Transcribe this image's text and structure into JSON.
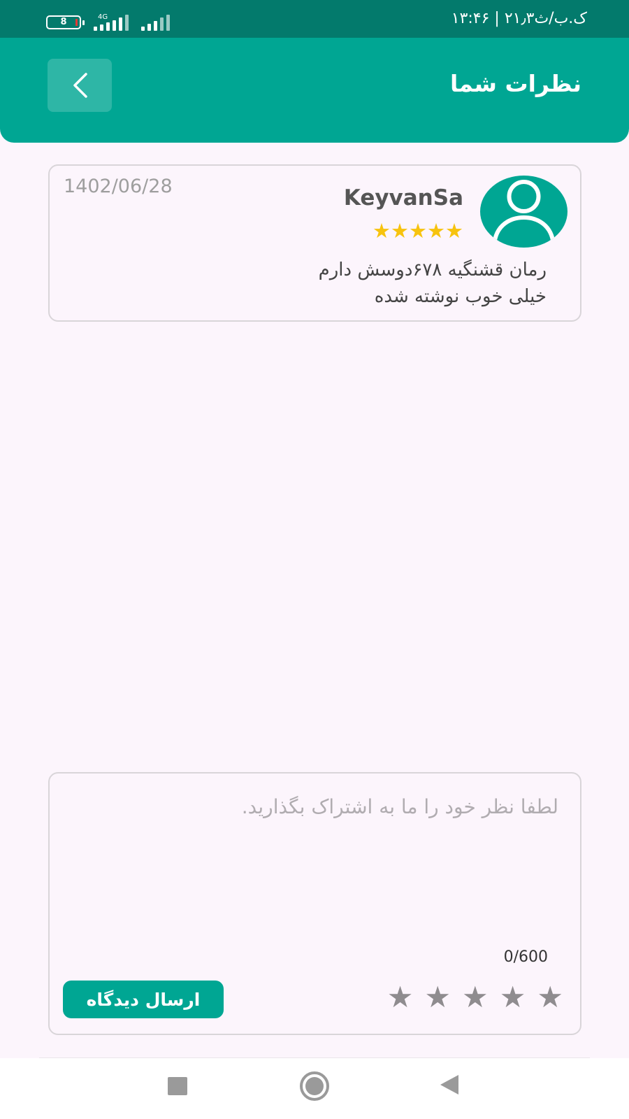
{
  "status_bar": {
    "time": "۱۳:۴۶ | ۲۱٫۳ک.ب/ث",
    "battery_level": "8",
    "network_label": "4G",
    "icons": [
      "battery-icon",
      "mobile-signal-icon",
      "wifi-signal-icon"
    ]
  },
  "header": {
    "title": "نظرات شما",
    "back_icon": "chevron-left-icon"
  },
  "reviews": [
    {
      "author": "KeyvanSa",
      "date": "1402/06/28",
      "rating": 5,
      "stars": "★★★★★",
      "text_line1": "رمان قشنگیه ۶۷۸دوسش دارم",
      "text_line2": "خیلی خوب نوشته شده"
    }
  ],
  "composer": {
    "placeholder": "لطفا نظر خود را ما به اشتراک بگذارید.",
    "value": "",
    "char_counter": "0/600",
    "rating_stars": [
      "★",
      "★",
      "★",
      "★",
      "★"
    ],
    "rating_selected": 0,
    "submit_label": "ارسال دیدگاه"
  },
  "nav": {
    "icons": [
      "recent-apps-icon",
      "home-icon",
      "back-triangle-icon"
    ]
  },
  "colors": {
    "primary": "#00a693",
    "status_bar": "#037a6c",
    "star_filled": "#f7c30e",
    "star_empty": "#8f8c8f",
    "background": "#fcf5fc"
  }
}
